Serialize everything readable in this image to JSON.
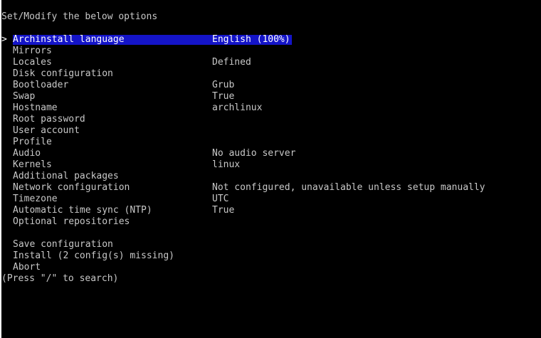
{
  "header": {
    "text": "Set/Modify the below options"
  },
  "cursor": ">",
  "menu": {
    "items": [
      {
        "label": "Archinstall language",
        "value": "English (100%)"
      },
      {
        "label": "Mirrors",
        "value": ""
      },
      {
        "label": "Locales",
        "value": "Defined"
      },
      {
        "label": "Disk configuration",
        "value": ""
      },
      {
        "label": "Bootloader",
        "value": "Grub"
      },
      {
        "label": "Swap",
        "value": "True"
      },
      {
        "label": "Hostname",
        "value": "archlinux"
      },
      {
        "label": "Root password",
        "value": ""
      },
      {
        "label": "User account",
        "value": ""
      },
      {
        "label": "Profile",
        "value": ""
      },
      {
        "label": "Audio",
        "value": "No audio server"
      },
      {
        "label": "Kernels",
        "value": "linux"
      },
      {
        "label": "Additional packages",
        "value": ""
      },
      {
        "label": "Network configuration",
        "value": "Not configured, unavailable unless setup manually"
      },
      {
        "label": "Timezone",
        "value": "UTC"
      },
      {
        "label": "Automatic time sync (NTP)",
        "value": "True"
      },
      {
        "label": "Optional repositories",
        "value": ""
      }
    ],
    "actions": [
      {
        "label": "Save configuration"
      },
      {
        "label": "Install (2 config(s) missing)"
      },
      {
        "label": "Abort"
      }
    ]
  },
  "footer": {
    "hint": "(Press \"/\" to search)"
  },
  "colors": {
    "background": "#000000",
    "text": "#c8c8c8",
    "selection": "#1414c8",
    "frame": "#ffffff"
  }
}
